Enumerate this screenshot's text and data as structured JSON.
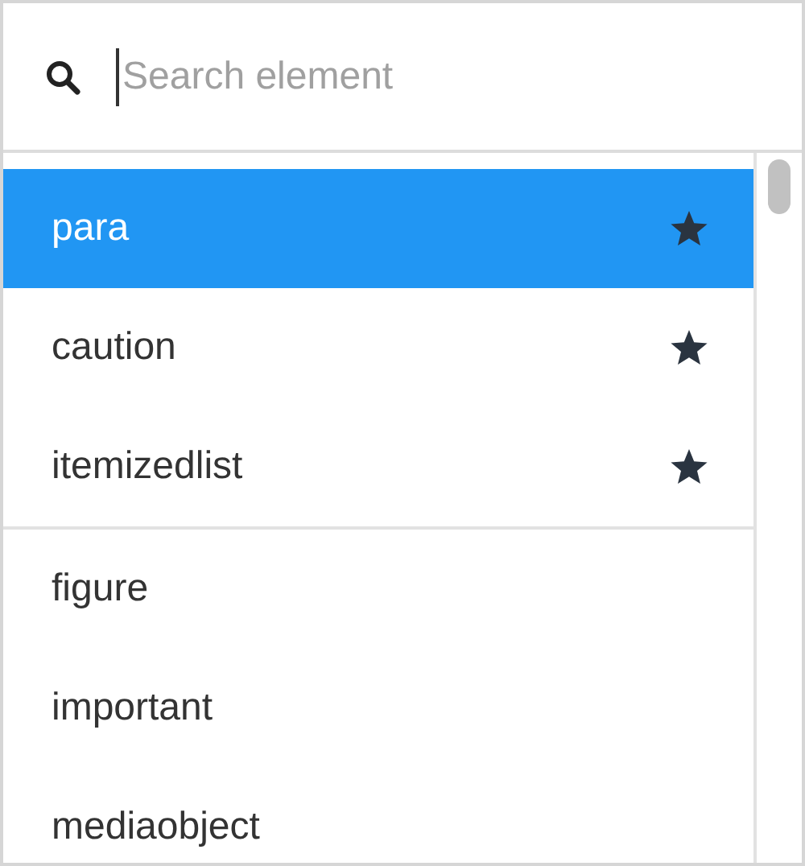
{
  "search": {
    "placeholder": "Search element"
  },
  "groups": [
    {
      "items": [
        {
          "label": "para",
          "selected": true,
          "favorite": true
        },
        {
          "label": "caution",
          "selected": false,
          "favorite": true
        },
        {
          "label": "itemizedlist",
          "selected": false,
          "favorite": true
        }
      ]
    },
    {
      "items": [
        {
          "label": "figure",
          "selected": false,
          "favorite": false
        },
        {
          "label": "important",
          "selected": false,
          "favorite": false
        },
        {
          "label": "mediaobject",
          "selected": false,
          "favorite": false
        }
      ]
    }
  ]
}
